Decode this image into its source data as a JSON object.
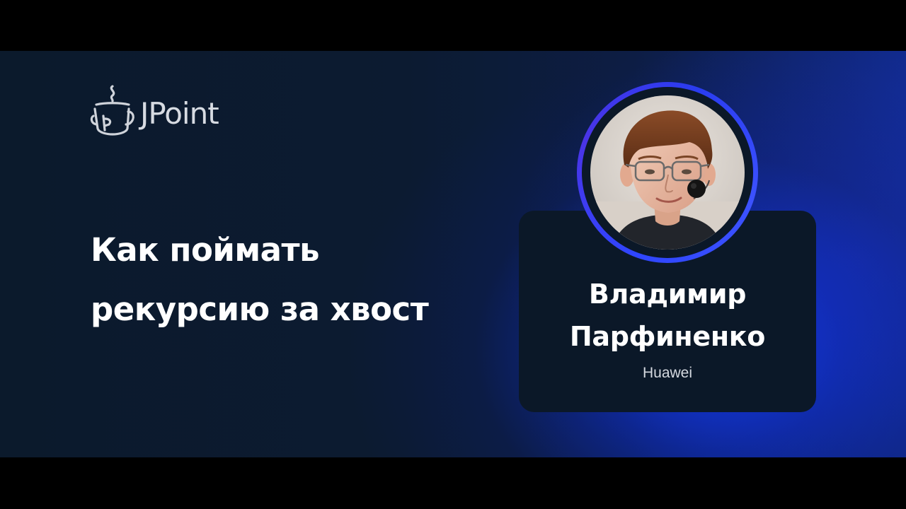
{
  "event": {
    "logo_text": "JPoint",
    "logo_icon": "coffee-cup-icon"
  },
  "talk": {
    "title_line1": "Как поймать",
    "title_line2": "рекурсию за хвост"
  },
  "speaker": {
    "name_line1": "Владимир",
    "name_line2": "Парфиненко",
    "company": "Huawei"
  },
  "colors": {
    "background": "#0b1a2c",
    "accent_ring": "#3a44f5",
    "card": "#0b1828",
    "text": "#ffffff"
  }
}
